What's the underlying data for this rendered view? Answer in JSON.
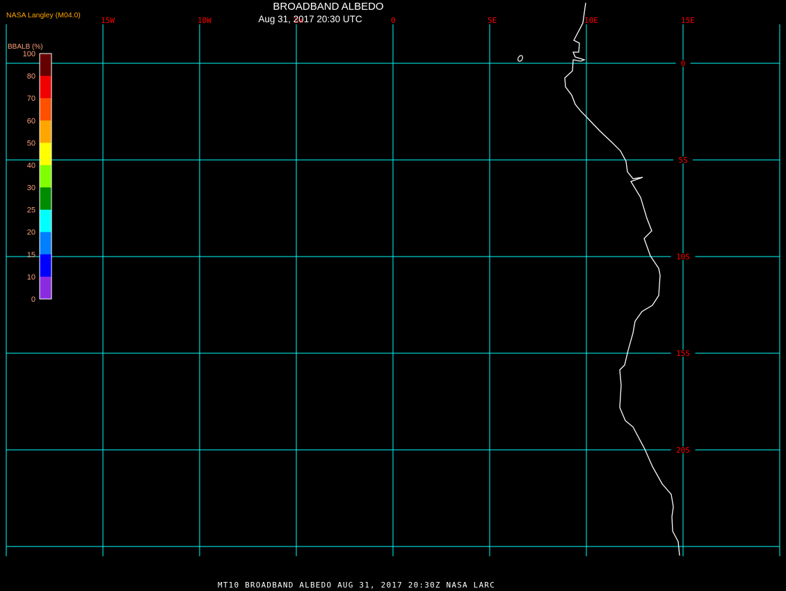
{
  "header": {
    "credit": "NASA Langley (M04.0)",
    "title": "BROADBAND ALBEDO",
    "subtitle": "Aug 31, 2017 20:30 UTC"
  },
  "footer": {
    "text": "MT10  BROADBAND ALBEDO   AUG 31, 2017 20:30Z   NASA LARC"
  },
  "map": {
    "longitude_labels": [
      "15W",
      "10W",
      "5W",
      "0",
      "5E",
      "10E",
      "15E"
    ],
    "longitude_values": [
      -15,
      -10,
      -5,
      0,
      5,
      10,
      15
    ],
    "latitude_labels": [
      "0",
      "5S",
      "10S",
      "15S",
      "20S"
    ],
    "latitude_values": [
      0,
      -5,
      -10,
      -15,
      -20
    ],
    "grid_color": "#00ffff",
    "label_color": "#ff0000",
    "coastline_color": "#ffffff",
    "background_color": "#000000"
  },
  "colorbar": {
    "title": "BBALB (%)",
    "labels": [
      "100",
      "80",
      "70",
      "60",
      "50",
      "40",
      "30",
      "25",
      "20",
      "15",
      "10",
      "0"
    ],
    "colors": [
      "#640000",
      "#f00000",
      "#ff5000",
      "#ffa500",
      "#ffff00",
      "#80ff00",
      "#008c00",
      "#00ffff",
      "#0080ff",
      "#0000ff",
      "#8a2be2"
    ]
  }
}
